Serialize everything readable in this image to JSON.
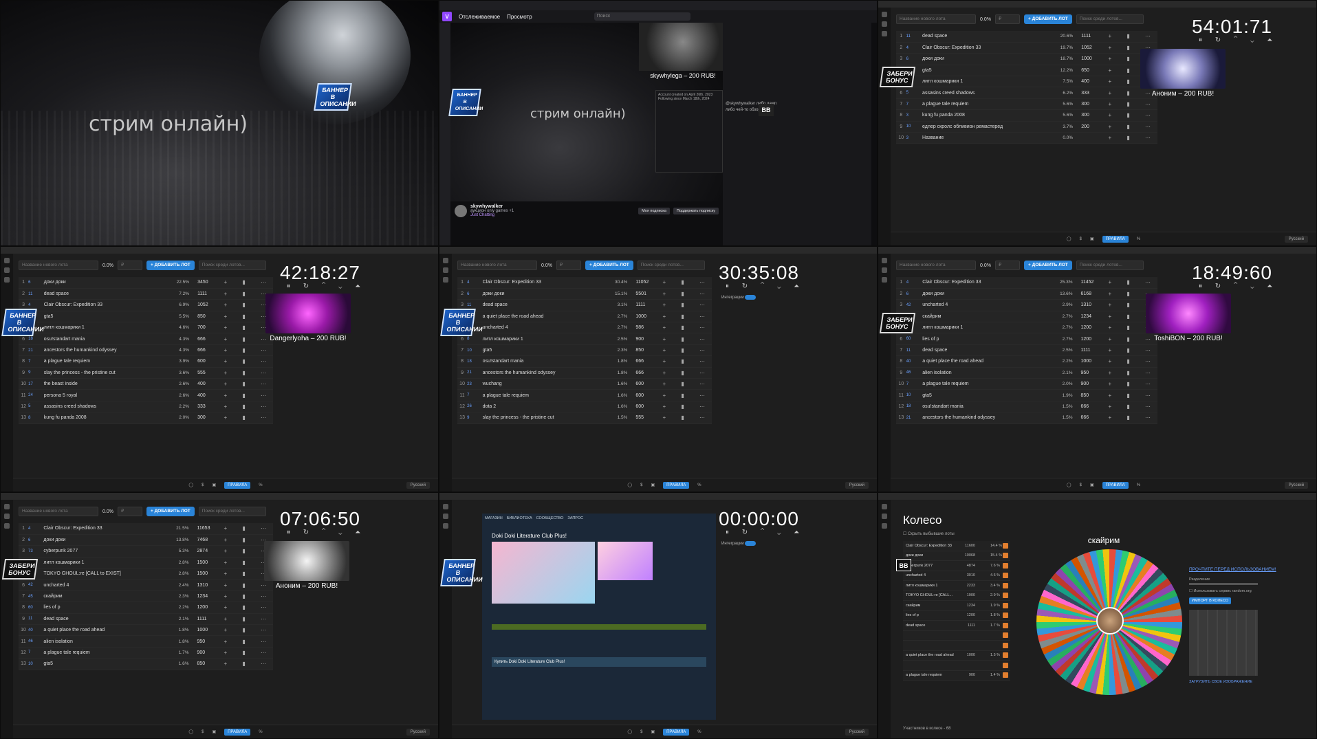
{
  "tiles": {
    "t1": {
      "caption": "стрим онлайн)",
      "banner": "БАННЕР В ОПИСАНИИ"
    },
    "t2": {
      "nav": [
        "Отслеживаемое",
        "Просмотр"
      ],
      "search_placeholder": "Поиск",
      "caption": "стрим онлайн)",
      "donation": "skywhylega – 200 RUB!",
      "chat": [
        "Account created on April 26th, 2023",
        "Following since March 18th, 2024",
        "@skywhywalker либо дамп",
        "либо чей-то обзор"
      ],
      "streamer": "skywhywalker",
      "stream_title": "аукцион only games +1",
      "category": "Just Chatting",
      "follow_btn": "Моя подписка",
      "sub_btn": "Поддержать подписку",
      "banner": "БАННЕР В ОПИСАНИИ"
    },
    "t3": {
      "timer": "54:01:71",
      "donation": "Аноним – 200 RUB!",
      "banner": "ЗАБЕРИ БОНУС",
      "rows": [
        {
          "n": "1",
          "id": "11",
          "name": "dead space",
          "pct": "20.6%",
          "amt": "1111"
        },
        {
          "n": "2",
          "id": "4",
          "name": "Clair Obscur: Expedition 33",
          "pct": "19.7%",
          "amt": "1052"
        },
        {
          "n": "3",
          "id": "6",
          "name": "доки доки",
          "pct": "18.7%",
          "amt": "1000"
        },
        {
          "n": "4",
          "id": "10",
          "name": "gta5",
          "pct": "12.2%",
          "amt": "650"
        },
        {
          "n": "5",
          "id": "11",
          "name": "литл кошмарики 1",
          "pct": "7.5%",
          "amt": "400"
        },
        {
          "n": "6",
          "id": "5",
          "name": "assasins creed shadows",
          "pct": "6.2%",
          "amt": "333"
        },
        {
          "n": "7",
          "id": "7",
          "name": "a plague tale requiem",
          "pct": "5.6%",
          "amt": "300"
        },
        {
          "n": "8",
          "id": "3",
          "name": "kung fu panda 2008",
          "pct": "5.6%",
          "amt": "300"
        },
        {
          "n": "9",
          "id": "10",
          "name": "едлер скролс обливион ремастеред",
          "pct": "3.7%",
          "amt": "200"
        },
        {
          "n": "10",
          "id": "3",
          "name": "Название",
          "pct": "0.0%",
          "amt": ""
        }
      ]
    },
    "t4": {
      "timer": "42:18:27",
      "donation": "Dangerlyoha – 200 RUB!",
      "banner": "БАННЕР В ОПИСАНИИ",
      "rows": [
        {
          "n": "1",
          "id": "6",
          "name": "доки доки",
          "pct": "22.5%",
          "amt": "3450"
        },
        {
          "n": "2",
          "id": "11",
          "name": "dead space",
          "pct": "7.2%",
          "amt": "1111"
        },
        {
          "n": "3",
          "id": "4",
          "name": "Clair Obscur: Expedition 33",
          "pct": "6.9%",
          "amt": "1052"
        },
        {
          "n": "4",
          "id": "10",
          "name": "gta5",
          "pct": "5.5%",
          "amt": "850"
        },
        {
          "n": "5",
          "id": "8",
          "name": "литл кошмарики 1",
          "pct": "4.6%",
          "amt": "700"
        },
        {
          "n": "6",
          "id": "18",
          "name": "osu!standart mania",
          "pct": "4.3%",
          "amt": "666"
        },
        {
          "n": "7",
          "id": "21",
          "name": "ancestors the humankind odyssey",
          "pct": "4.3%",
          "amt": "666"
        },
        {
          "n": "8",
          "id": "7",
          "name": "a plague tale requiem",
          "pct": "3.9%",
          "amt": "600"
        },
        {
          "n": "9",
          "id": "9",
          "name": "slay the princess - the pristine cut",
          "pct": "3.6%",
          "amt": "555"
        },
        {
          "n": "10",
          "id": "17",
          "name": "the beast inside",
          "pct": "2.6%",
          "amt": "400"
        },
        {
          "n": "11",
          "id": "24",
          "name": "persona 5 royal",
          "pct": "2.6%",
          "amt": "400"
        },
        {
          "n": "12",
          "id": "5",
          "name": "assasins creed shadows",
          "pct": "2.2%",
          "amt": "333"
        },
        {
          "n": "13",
          "id": "8",
          "name": "kung fu panda 2008",
          "pct": "2.0%",
          "amt": "300"
        }
      ]
    },
    "t5": {
      "timer": "30:35:08",
      "integration": "Интеграции",
      "banner": "БАННЕР В ОПИСАНИИ",
      "rows": [
        {
          "n": "1",
          "id": "4",
          "name": "Clair Obscur: Expedition 33",
          "pct": "30.4%",
          "amt": "11052"
        },
        {
          "n": "2",
          "id": "6",
          "name": "доки доки",
          "pct": "15.1%",
          "amt": "5501"
        },
        {
          "n": "3",
          "id": "11",
          "name": "dead space",
          "pct": "3.1%",
          "amt": "1111"
        },
        {
          "n": "4",
          "id": "40",
          "name": "a quiet place the road ahead",
          "pct": "2.7%",
          "amt": "1000"
        },
        {
          "n": "5",
          "id": "42",
          "name": "uncharted 4",
          "pct": "2.7%",
          "amt": "986"
        },
        {
          "n": "6",
          "id": "8",
          "name": "литл кошмарики 1",
          "pct": "2.5%",
          "amt": "900"
        },
        {
          "n": "7",
          "id": "10",
          "name": "gta5",
          "pct": "2.3%",
          "amt": "850"
        },
        {
          "n": "8",
          "id": "18",
          "name": "osu!standart mania",
          "pct": "1.8%",
          "amt": "666"
        },
        {
          "n": "9",
          "id": "21",
          "name": "ancestors the humankind odyssey",
          "pct": "1.8%",
          "amt": "666"
        },
        {
          "n": "10",
          "id": "23",
          "name": "wuchang",
          "pct": "1.6%",
          "amt": "600"
        },
        {
          "n": "11",
          "id": "7",
          "name": "a plague tale requiem",
          "pct": "1.6%",
          "amt": "600"
        },
        {
          "n": "12",
          "id": "26",
          "name": "dota 2",
          "pct": "1.6%",
          "amt": "600"
        },
        {
          "n": "13",
          "id": "9",
          "name": "slay the princess - the pristine cut",
          "pct": "1.5%",
          "amt": "555"
        }
      ]
    },
    "t6": {
      "timer": "18:49:60",
      "donation": "ToshiBON – 200 RUB!",
      "banner": "ЗАБЕРИ БОНУС",
      "rows": [
        {
          "n": "1",
          "id": "4",
          "name": "Clair Obscur: Expedition 33",
          "pct": "25.3%",
          "amt": "11452"
        },
        {
          "n": "2",
          "id": "6",
          "name": "доки доки",
          "pct": "13.6%",
          "amt": "6168"
        },
        {
          "n": "3",
          "id": "42",
          "name": "uncharted 4",
          "pct": "2.9%",
          "amt": "1310"
        },
        {
          "n": "4",
          "id": "45",
          "name": "скайрим",
          "pct": "2.7%",
          "amt": "1234"
        },
        {
          "n": "5",
          "id": "8",
          "name": "литл кошмарики 1",
          "pct": "2.7%",
          "amt": "1200"
        },
        {
          "n": "6",
          "id": "60",
          "name": "lies of p",
          "pct": "2.7%",
          "amt": "1200"
        },
        {
          "n": "7",
          "id": "11",
          "name": "dead space",
          "pct": "2.5%",
          "amt": "1111"
        },
        {
          "n": "8",
          "id": "40",
          "name": "a quiet place the road ahead",
          "pct": "2.2%",
          "amt": "1000"
        },
        {
          "n": "9",
          "id": "46",
          "name": "alien isolation",
          "pct": "2.1%",
          "amt": "950"
        },
        {
          "n": "10",
          "id": "7",
          "name": "a plague tale requiem",
          "pct": "2.0%",
          "amt": "900"
        },
        {
          "n": "11",
          "id": "10",
          "name": "gta5",
          "pct": "1.9%",
          "amt": "850"
        },
        {
          "n": "12",
          "id": "18",
          "name": "osu!standart mania",
          "pct": "1.5%",
          "amt": "666"
        },
        {
          "n": "13",
          "id": "21",
          "name": "ancestors the humankind odyssey",
          "pct": "1.5%",
          "amt": "666"
        }
      ]
    },
    "t7": {
      "timer": "07:06:50",
      "donation": "Аноним – 200 RUB!",
      "banner": "ЗАБЕРИ БОНУС",
      "rows": [
        {
          "n": "1",
          "id": "4",
          "name": "Clair Obscur: Expedition 33",
          "pct": "21.5%",
          "amt": "11653"
        },
        {
          "n": "2",
          "id": "6",
          "name": "доки доки",
          "pct": "13.8%",
          "amt": "7468"
        },
        {
          "n": "3",
          "id": "73",
          "name": "cyberpunk 2077",
          "pct": "5.3%",
          "amt": "2874"
        },
        {
          "n": "4",
          "id": "8",
          "name": "литл кошмарики 1",
          "pct": "2.8%",
          "amt": "1500"
        },
        {
          "n": "5",
          "id": "76",
          "name": "TOKYO GHOUL:re [CALL to EXIST]",
          "pct": "2.8%",
          "amt": "1500"
        },
        {
          "n": "6",
          "id": "42",
          "name": "uncharted 4",
          "pct": "2.4%",
          "amt": "1310"
        },
        {
          "n": "7",
          "id": "45",
          "name": "скайрим",
          "pct": "2.3%",
          "amt": "1234"
        },
        {
          "n": "8",
          "id": "60",
          "name": "lies of p",
          "pct": "2.2%",
          "amt": "1200"
        },
        {
          "n": "9",
          "id": "11",
          "name": "dead space",
          "pct": "2.1%",
          "amt": "1111"
        },
        {
          "n": "10",
          "id": "40",
          "name": "a quiet place the road ahead",
          "pct": "1.8%",
          "amt": "1000"
        },
        {
          "n": "11",
          "id": "46",
          "name": "alien isolation",
          "pct": "1.8%",
          "amt": "950"
        },
        {
          "n": "12",
          "id": "7",
          "name": "a plague tale requiem",
          "pct": "1.7%",
          "amt": "900"
        },
        {
          "n": "13",
          "id": "10",
          "name": "gta5",
          "pct": "1.6%",
          "amt": "850"
        }
      ]
    },
    "t8": {
      "timer": "00:00:00",
      "integration": "Интеграции",
      "banner": "БАННЕР В ОПИСАНИИ",
      "steam_title": "Doki Doki Literature Club Plus!",
      "steam_tabs": [
        "МАГАЗИН",
        "БИБЛИОТЕКА",
        "СООБЩЕСТВО",
        "ЗАПРОС"
      ],
      "steam_buy": "Купить Doki Doki Literature Club Plus!"
    },
    "t9": {
      "title": "Колесо",
      "hide_checkbox": "Скрыть выбывшие лоты",
      "wheel_label": "скайрим",
      "read_before": "ПРОЧТИТЕ ПЕРЕД ИСПОЛЬЗОВАНИЕМ!",
      "split": "Разделение",
      "random_org": "Использовать сервис random.org",
      "import": "ИМПОРТ В КОЛЕСО",
      "upload": "ЗАГРУЗИТЬ СВОЕ ИЗОБРАЖЕНИЕ",
      "participants": "Участников в колесе - 68",
      "list": [
        {
          "name": "Clair Obscur: Expedition 33",
          "amt": "11600",
          "pct": "14.4 %"
        },
        {
          "name": "доки доки",
          "amt": "10068",
          "pct": "15.4 %"
        },
        {
          "name": "cyberpunk 2077",
          "amt": "4874",
          "pct": "7.6 %"
        },
        {
          "name": "uncharted 4",
          "amt": "3010",
          "pct": "4.6 %"
        },
        {
          "name": "литл кошмарики 1",
          "amt": "2233",
          "pct": "3.4 %"
        },
        {
          "name": "TOKYO GHOUL:re [CALL...",
          "amt": "1900",
          "pct": "2.9 %"
        },
        {
          "name": "скайрим",
          "amt": "1234",
          "pct": "1.9 %"
        },
        {
          "name": "lies of p",
          "amt": "1200",
          "pct": "1.8 %"
        },
        {
          "name": "dead space",
          "amt": "1111",
          "pct": "1.7 %"
        },
        {
          "name": "",
          "amt": "",
          "pct": ""
        },
        {
          "name": "",
          "amt": "",
          "pct": ""
        },
        {
          "name": "a quiet place the road ahead",
          "amt": "1000",
          "pct": "1.5 %"
        },
        {
          "name": "",
          "amt": "",
          "pct": ""
        },
        {
          "name": "a plague tale requiem",
          "amt": "900",
          "pct": "1.4 %"
        }
      ]
    }
  },
  "common": {
    "new_lot_placeholder": "Название нового лота",
    "zero_pct": "0.0%",
    "currency_placeholder": "₽",
    "add_lot": "+ ДОБАВИТЬ ЛОТ",
    "search_placeholder": "Поиск среди лотов...",
    "rules": "ПРАВИЛА",
    "language": "Русский",
    "timer_controls": "⏸ ↻ ⌃ ⌄ ⏶"
  },
  "colors": {
    "accent": "#2a84d8",
    "twitch": "#9147ff",
    "bg": "#1e1e1e"
  }
}
